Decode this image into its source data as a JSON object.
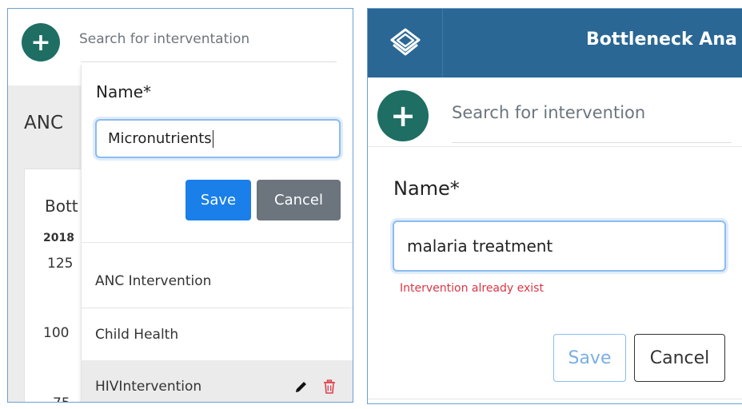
{
  "left_panel": {
    "search": {
      "placeholder": "Search for interventation"
    },
    "page_title": "ANC",
    "card": {
      "title": "Bott",
      "year": "2018",
      "y_ticks": [
        "125",
        "100",
        "75"
      ]
    },
    "form": {
      "name_label": "Name*",
      "name_value": "Micronutrients",
      "save_label": "Save",
      "cancel_label": "Cancel"
    },
    "list_items": [
      {
        "label": "ANC Intervention"
      },
      {
        "label": "Child Health"
      },
      {
        "label": "HIVIntervention",
        "icons": [
          "pencil-icon",
          "trash-icon"
        ]
      }
    ]
  },
  "right_panel": {
    "header": {
      "title": "Bottleneck Ana"
    },
    "search": {
      "placeholder": "Search for intervention"
    },
    "form": {
      "name_label": "Name*",
      "name_value": "malaria treatment",
      "error": "Intervention already exist",
      "save_label": "Save",
      "cancel_label": "Cancel"
    }
  },
  "colors": {
    "add_button": "#1e6e63",
    "topbar": "#2a6794",
    "primary": "#1a7fe8",
    "secondary": "#6c757d",
    "danger": "#dc3545",
    "panel_border": "#6a9fd4"
  },
  "icons": [
    "plus-icon",
    "layers-logo-icon",
    "pencil-icon",
    "trash-icon"
  ]
}
